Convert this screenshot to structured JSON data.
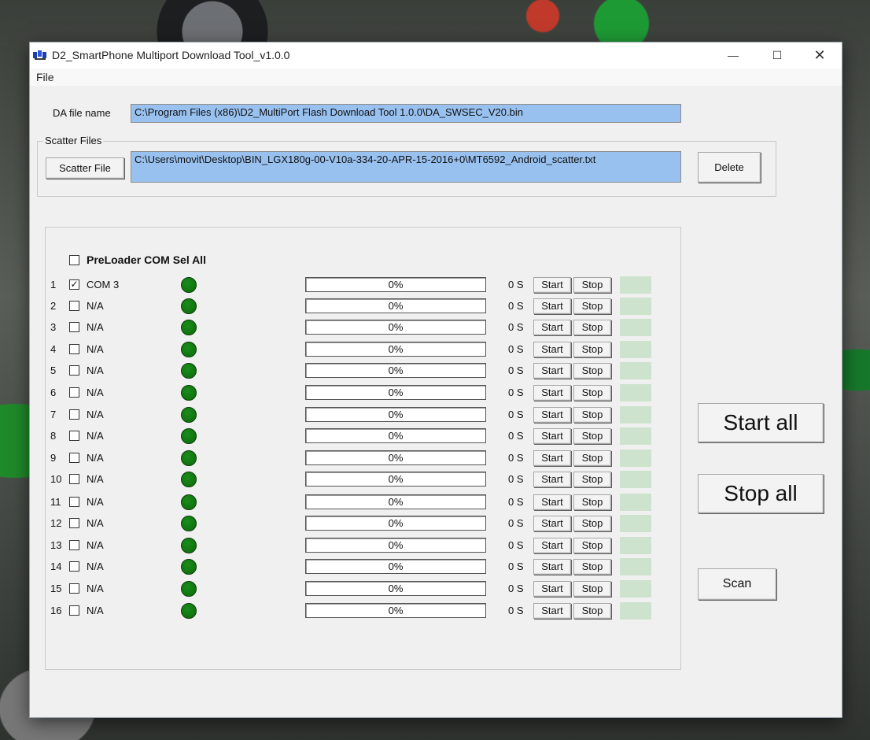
{
  "window": {
    "title": "D2_SmartPhone Multiport Download Tool_v1.0.0"
  },
  "menu": {
    "file": "File"
  },
  "da": {
    "label": "DA file name",
    "path": "C:\\Program Files (x86)\\D2_MultiPort Flash Download Tool 1.0.0\\DA_SWSEC_V20.bin"
  },
  "scatter": {
    "group_title": "Scatter Files",
    "button": "Scatter File",
    "path": "C:\\Users\\movit\\Desktop\\BIN_LGX180g-00-V10a-334-20-APR-15-2016+0\\MT6592_Android_scatter.txt",
    "delete": "Delete"
  },
  "preloader": {
    "label": "PreLoader COM Sel All",
    "checked": false
  },
  "row_labels": {
    "start": "Start",
    "stop": "Stop"
  },
  "ports": [
    {
      "num": "1",
      "port": "COM 3",
      "checked": true,
      "progress": "0%",
      "time": "0 S"
    },
    {
      "num": "2",
      "port": "N/A",
      "checked": false,
      "progress": "0%",
      "time": "0 S"
    },
    {
      "num": "3",
      "port": "N/A",
      "checked": false,
      "progress": "0%",
      "time": "0 S"
    },
    {
      "num": "4",
      "port": "N/A",
      "checked": false,
      "progress": "0%",
      "time": "0 S"
    },
    {
      "num": "5",
      "port": "N/A",
      "checked": false,
      "progress": "0%",
      "time": "0 S"
    },
    {
      "num": "6",
      "port": "N/A",
      "checked": false,
      "progress": "0%",
      "time": "0 S"
    },
    {
      "num": "7",
      "port": "N/A",
      "checked": false,
      "progress": "0%",
      "time": "0 S"
    },
    {
      "num": "8",
      "port": "N/A",
      "checked": false,
      "progress": "0%",
      "time": "0 S"
    },
    {
      "num": "9",
      "port": "N/A",
      "checked": false,
      "progress": "0%",
      "time": "0 S"
    },
    {
      "num": "10",
      "port": "N/A",
      "checked": false,
      "progress": "0%",
      "time": "0 S"
    },
    {
      "num": "11",
      "port": "N/A",
      "checked": false,
      "progress": "0%",
      "time": "0 S"
    },
    {
      "num": "12",
      "port": "N/A",
      "checked": false,
      "progress": "0%",
      "time": "0 S"
    },
    {
      "num": "13",
      "port": "N/A",
      "checked": false,
      "progress": "0%",
      "time": "0 S"
    },
    {
      "num": "14",
      "port": "N/A",
      "checked": false,
      "progress": "0%",
      "time": "0 S"
    },
    {
      "num": "15",
      "port": "N/A",
      "checked": false,
      "progress": "0%",
      "time": "0 S"
    },
    {
      "num": "16",
      "port": "N/A",
      "checked": false,
      "progress": "0%",
      "time": "0 S"
    }
  ],
  "actions": {
    "start_all": "Start all",
    "stop_all": "Stop all",
    "scan": "Scan"
  },
  "colors": {
    "field_bg": "#99c1ef",
    "led": "#0f7a0f",
    "status_cell": "#cde3cd"
  },
  "icons": {
    "app": "network-icon",
    "minimize": "minimize-icon",
    "maximize": "maximize-icon",
    "close": "close-icon"
  }
}
